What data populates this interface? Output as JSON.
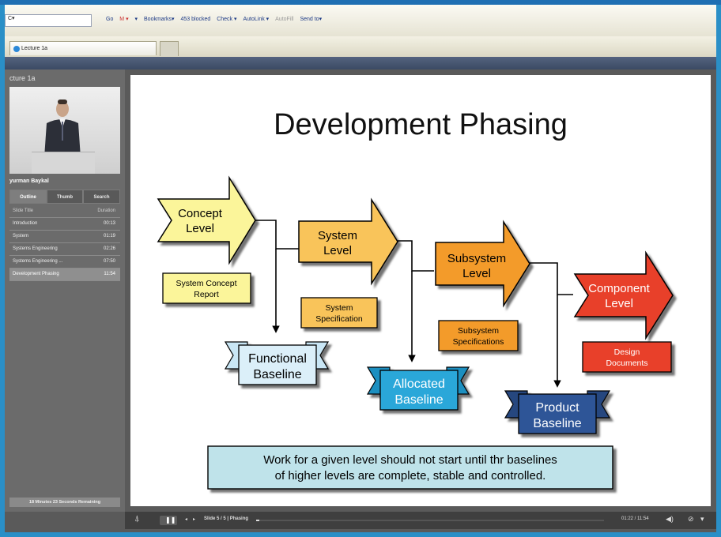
{
  "browser": {
    "address": "C▾",
    "toolbar_items": [
      "Go",
      "M ▾",
      "▾",
      "Bookmarks▾",
      "453 blocked",
      "Check ▾",
      "AutoLink ▾",
      "AutoFill",
      "Send to▾"
    ],
    "tab_label": "Lecture 1a"
  },
  "sidebar": {
    "title": "cture 1a",
    "speaker": "yurman Baykal",
    "tabs": [
      "Outline",
      "Thumb",
      "Search"
    ],
    "list_header": {
      "title": "Slide Title",
      "duration": "Duration"
    },
    "items": [
      {
        "title": "Introduction",
        "duration": "00:13"
      },
      {
        "title": "System",
        "duration": "01:19"
      },
      {
        "title": "Systems Engineering",
        "duration": "02:26"
      },
      {
        "title": "Systems Engineering ...",
        "duration": "07:50"
      },
      {
        "title": "Development Phasing",
        "duration": "11:54"
      }
    ],
    "remaining": "18 Minutes 23 Seconds Remaining"
  },
  "slide": {
    "title": "Development Phasing",
    "levels": [
      {
        "line1": "Concept",
        "line2": "Level",
        "color": "#fbf59a"
      },
      {
        "line1": "System",
        "line2": "Level",
        "color": "#f9c45a"
      },
      {
        "line1": "Subsystem",
        "line2": "Level",
        "color": "#f39b2a"
      },
      {
        "line1": "Component",
        "line2": "Level",
        "color": "#e8412a"
      }
    ],
    "documents": [
      {
        "line1": "System Concept",
        "line2": "Report"
      },
      {
        "line1": "System",
        "line2": "Specification"
      },
      {
        "line1": "Subsystem",
        "line2": "Specifications"
      },
      {
        "line1": "Design",
        "line2": "Documents"
      }
    ],
    "baselines": [
      {
        "line1": "Functional",
        "line2": "Baseline"
      },
      {
        "line1": "Allocated",
        "line2": "Baseline"
      },
      {
        "line1": "Product",
        "line2": "Baseline"
      }
    ],
    "note_line1": "Work for a given level should not start until thr baselines",
    "note_line2": "of higher levels are complete, stable and controlled."
  },
  "controls": {
    "slide_counter": "Slide 5 / 5 | Phasing",
    "time": "01:22 / 11:54"
  }
}
